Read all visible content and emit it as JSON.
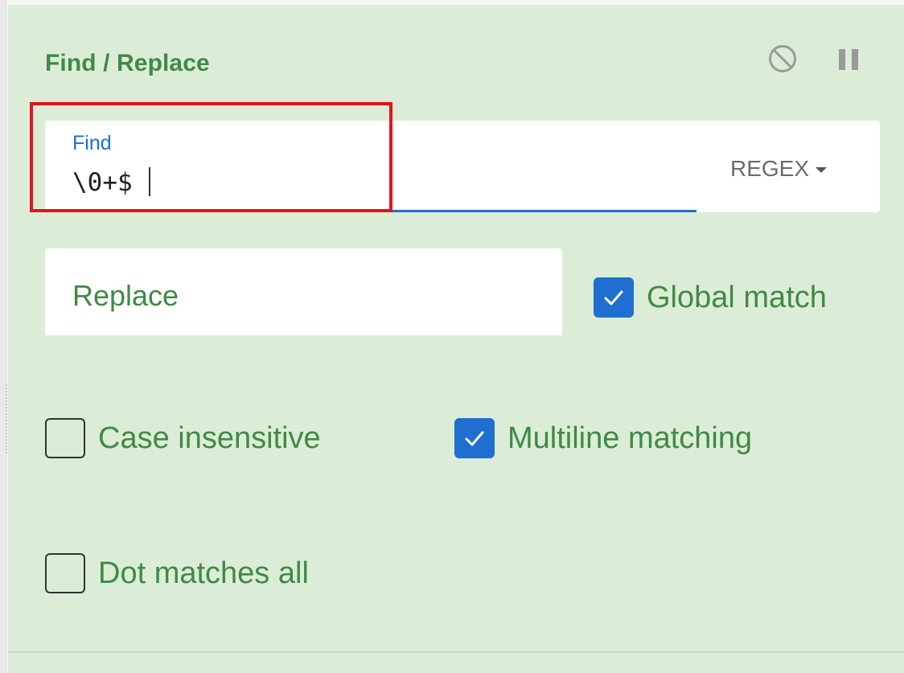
{
  "panel": {
    "title": "Find / Replace",
    "background_color": "#dcedd7",
    "accent_color": "#1e6fcf",
    "label_color": "#3f8a45",
    "header_icons": [
      "disable-icon",
      "pause-icon"
    ]
  },
  "find": {
    "label": "Find",
    "value": "\\0+$",
    "mode_label": "REGEX",
    "highlight_color": "#e3131b"
  },
  "replace": {
    "placeholder": "Replace",
    "value": ""
  },
  "options": {
    "global_match": {
      "label": "Global match",
      "checked": true
    },
    "case_insensitive": {
      "label": "Case insensitive",
      "checked": false
    },
    "multiline_matching": {
      "label": "Multiline matching",
      "checked": true
    },
    "dot_matches_all": {
      "label": "Dot matches all",
      "checked": false
    }
  }
}
